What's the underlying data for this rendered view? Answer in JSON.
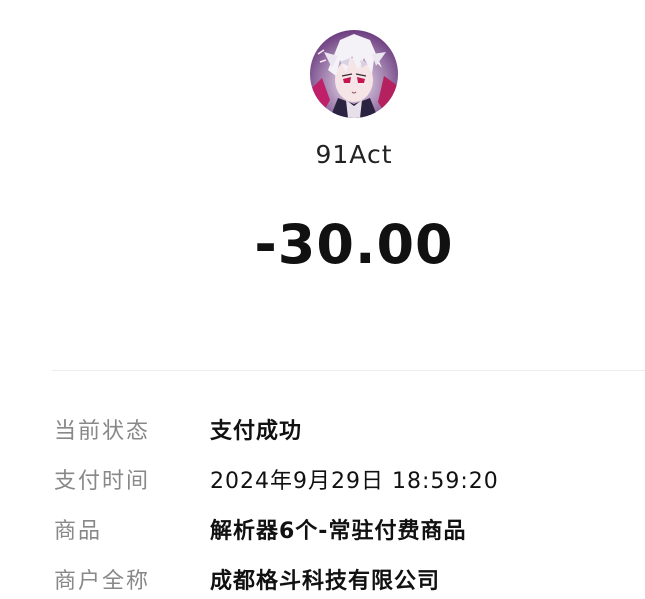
{
  "merchant": {
    "name": "91Act",
    "avatar_icon": "anime-character-avatar-icon"
  },
  "payment": {
    "amount": "-30.00"
  },
  "details": [
    {
      "label": "当前状态",
      "value": "支付成功"
    },
    {
      "label": "支付时间",
      "value": "2024年9月29日 18:59:20"
    },
    {
      "label": "商品",
      "value": "解析器6个-常驻付费商品"
    },
    {
      "label": "商户全称",
      "value": "成都格斗科技有限公司"
    }
  ],
  "colors": {
    "label": "#888888",
    "value": "#111111",
    "divider": "#ececec",
    "background": "#ffffff"
  }
}
